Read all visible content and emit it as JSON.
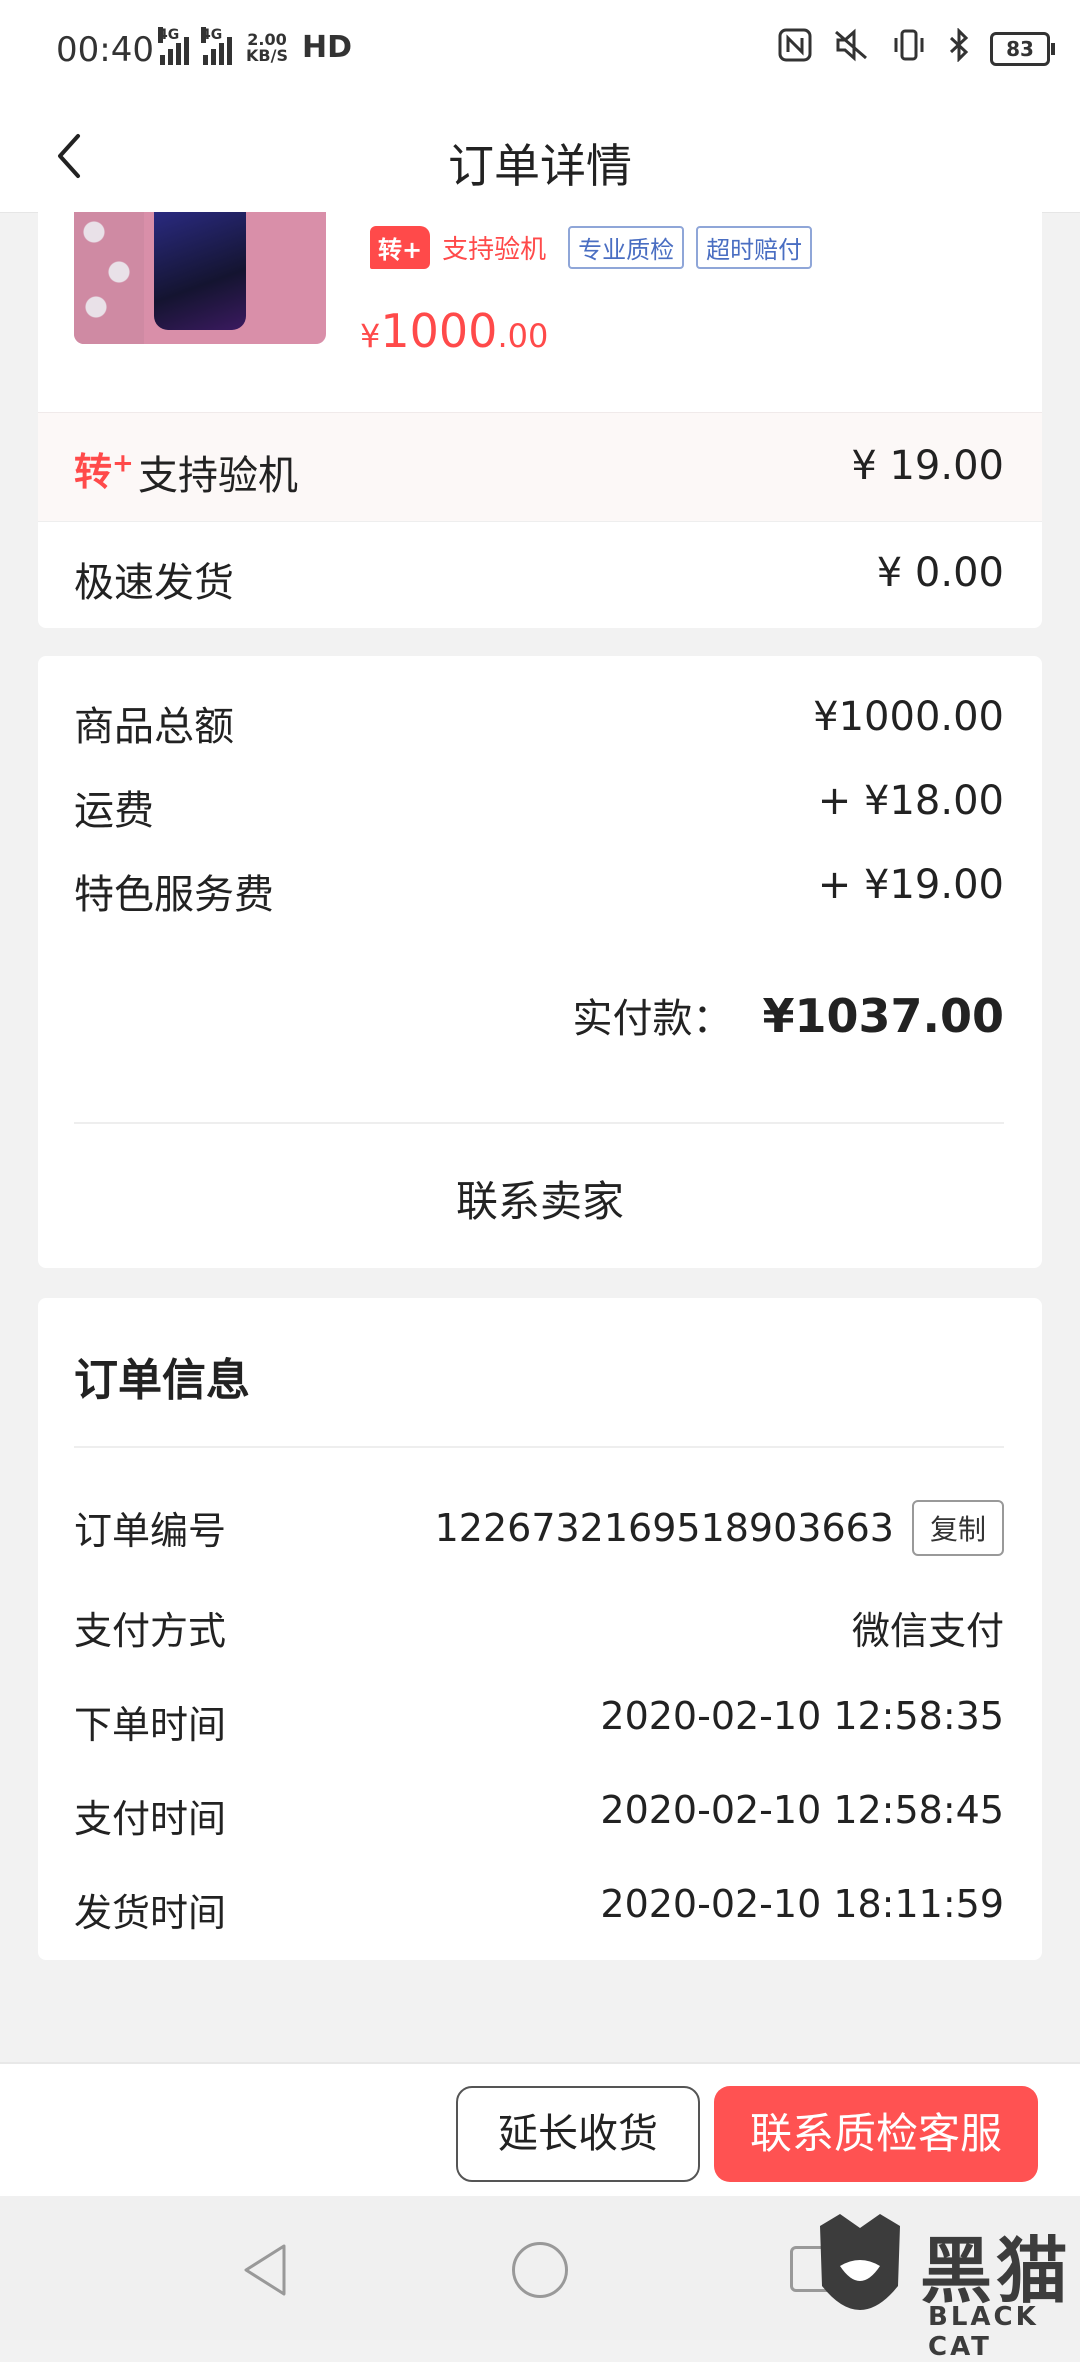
{
  "status_bar": {
    "time": "00:40",
    "net1": "4G",
    "net2": "4G",
    "speed_value": "2.00",
    "speed_unit": "KB/S",
    "hd": "HD",
    "battery": "83"
  },
  "header": {
    "title": "订单详情"
  },
  "product": {
    "badge": "转+",
    "tag_support": "支持验机",
    "tag_quality": "专业质检",
    "tag_compensate": "超时赔付",
    "price_yen": "¥",
    "price_int": "1000",
    "price_dec": ".00"
  },
  "services": {
    "zhuan_mark": "转",
    "zhuan_plus": "+",
    "inspect_label": "支持验机",
    "inspect_value": "¥ 19.00",
    "express_label": "极速发货",
    "express_value": "¥ 0.00"
  },
  "summary": {
    "goods_label": "商品总额",
    "goods_value": "¥1000.00",
    "shipping_label": "运费",
    "shipping_value": "+ ¥18.00",
    "service_label": "特色服务费",
    "service_value": "+ ¥19.00",
    "paid_label": "实付款：",
    "paid_value": "¥1037.00",
    "contact_seller": "联系卖家"
  },
  "order_info": {
    "title": "订单信息",
    "order_no_label": "订单编号",
    "order_no_value": "1226732169518903663",
    "copy_label": "复制",
    "pay_method_label": "支付方式",
    "pay_method_value": "微信支付",
    "order_time_label": "下单时间",
    "order_time_value": "2020-02-10 12:58:35",
    "pay_time_label": "支付时间",
    "pay_time_value": "2020-02-10 12:58:45",
    "ship_time_label": "发货时间",
    "ship_time_value": "2020-02-10 18:11:59"
  },
  "actions": {
    "extend_receipt": "延长收货",
    "contact_qc": "联系质检客服"
  },
  "watermark": {
    "cn": "黑猫",
    "en": "BLACK CAT"
  },
  "colors": {
    "accent": "#ff4a4a",
    "tag_blue": "#4a6ec2"
  }
}
